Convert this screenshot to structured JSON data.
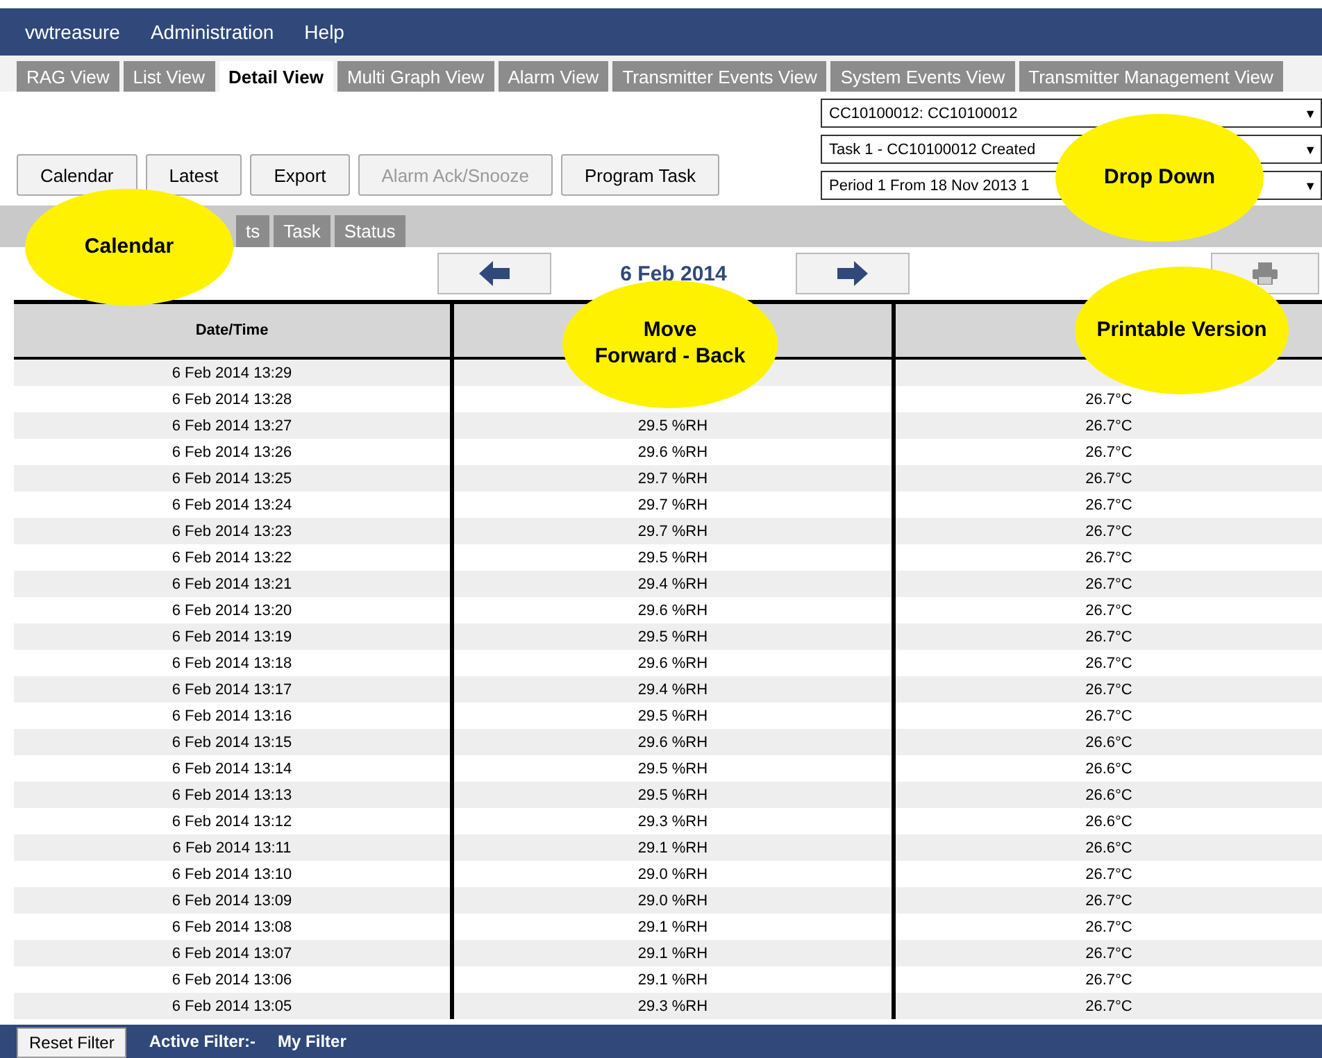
{
  "menu": [
    "vwtreasure",
    "Administration",
    "Help"
  ],
  "tabs": [
    {
      "label": "RAG View",
      "selected": false
    },
    {
      "label": "List View",
      "selected": false
    },
    {
      "label": "Detail View",
      "selected": true
    },
    {
      "label": "Multi Graph View",
      "selected": false
    },
    {
      "label": "Alarm View",
      "selected": false
    },
    {
      "label": "Transmitter Events View",
      "selected": false
    },
    {
      "label": "System Events View",
      "selected": false
    },
    {
      "label": "Transmitter Management View",
      "selected": false
    }
  ],
  "buttons": [
    {
      "label": "Calendar",
      "disabled": false
    },
    {
      "label": "Latest",
      "disabled": false
    },
    {
      "label": "Export",
      "disabled": false
    },
    {
      "label": "Alarm Ack/Snooze",
      "disabled": true
    },
    {
      "label": "Program Task",
      "disabled": false
    }
  ],
  "dropdowns": [
    {
      "value": "CC10100012: CC10100012",
      "caret": "▼"
    },
    {
      "value": "Task 1 - CC10100012 Created",
      "caret": "▼"
    },
    {
      "value": "Period 1 From 18 Nov 2013 1",
      "caret": "▼"
    }
  ],
  "subtabs": [
    {
      "label": "ts",
      "selected": false
    },
    {
      "label": "Task",
      "selected": false
    },
    {
      "label": "Status",
      "selected": false
    }
  ],
  "date": "6 Feb 2014",
  "table": {
    "columns": [
      "Date/Time"
    ],
    "rows": [
      {
        "time": "6 Feb 2014 13:29"
      },
      {
        "time": "6 Feb 2014 13:28",
        "temperature": "26.7°C"
      },
      {
        "time": "6 Feb 2014 13:27",
        "humidity": "29.5 %RH",
        "temperature": "26.7°C"
      },
      {
        "time": "6 Feb 2014 13:26",
        "humidity": "29.6 %RH",
        "temperature": "26.7°C"
      },
      {
        "time": "6 Feb 2014 13:25",
        "humidity": "29.7 %RH",
        "temperature": "26.7°C"
      },
      {
        "time": "6 Feb 2014 13:24",
        "humidity": "29.7 %RH",
        "temperature": "26.7°C"
      },
      {
        "time": "6 Feb 2014 13:23",
        "humidity": "29.7 %RH",
        "temperature": "26.7°C"
      },
      {
        "time": "6 Feb 2014 13:22",
        "humidity": "29.5 %RH",
        "temperature": "26.7°C"
      },
      {
        "time": "6 Feb 2014 13:21",
        "humidity": "29.4 %RH",
        "temperature": "26.7°C"
      },
      {
        "time": "6 Feb 2014 13:20",
        "humidity": "29.6 %RH",
        "temperature": "26.7°C"
      },
      {
        "time": "6 Feb 2014 13:19",
        "humidity": "29.5 %RH",
        "temperature": "26.7°C"
      },
      {
        "time": "6 Feb 2014 13:18",
        "humidity": "29.6 %RH",
        "temperature": "26.7°C"
      },
      {
        "time": "6 Feb 2014 13:17",
        "humidity": "29.4 %RH",
        "temperature": "26.7°C"
      },
      {
        "time": "6 Feb 2014 13:16",
        "humidity": "29.5 %RH",
        "temperature": "26.7°C"
      },
      {
        "time": "6 Feb 2014 13:15",
        "humidity": "29.6 %RH",
        "temperature": "26.6°C"
      },
      {
        "time": "6 Feb 2014 13:14",
        "humidity": "29.5 %RH",
        "temperature": "26.6°C"
      },
      {
        "time": "6 Feb 2014 13:13",
        "humidity": "29.5 %RH",
        "temperature": "26.6°C"
      },
      {
        "time": "6 Feb 2014 13:12",
        "humidity": "29.3 %RH",
        "temperature": "26.6°C"
      },
      {
        "time": "6 Feb 2014 13:11",
        "humidity": "29.1 %RH",
        "temperature": "26.6°C"
      },
      {
        "time": "6 Feb 2014 13:10",
        "humidity": "29.0 %RH",
        "temperature": "26.7°C"
      },
      {
        "time": "6 Feb 2014 13:09",
        "humidity": "29.0 %RH",
        "temperature": "26.7°C"
      },
      {
        "time": "6 Feb 2014 13:08",
        "humidity": "29.1 %RH",
        "temperature": "26.7°C"
      },
      {
        "time": "6 Feb 2014 13:07",
        "humidity": "29.1 %RH",
        "temperature": "26.7°C"
      },
      {
        "time": "6 Feb 2014 13:06",
        "humidity": "29.1 %RH",
        "temperature": "26.7°C"
      },
      {
        "time": "6 Feb 2014 13:05",
        "humidity": "29.3 %RH",
        "temperature": "26.7°C"
      }
    ]
  },
  "footer": {
    "button": "Reset Filter",
    "label": "Active Filter:-",
    "filter": "My Filter"
  },
  "callouts": [
    "Calendar",
    "Drop Down",
    "Move\nForward - Back",
    "Printable Version"
  ]
}
